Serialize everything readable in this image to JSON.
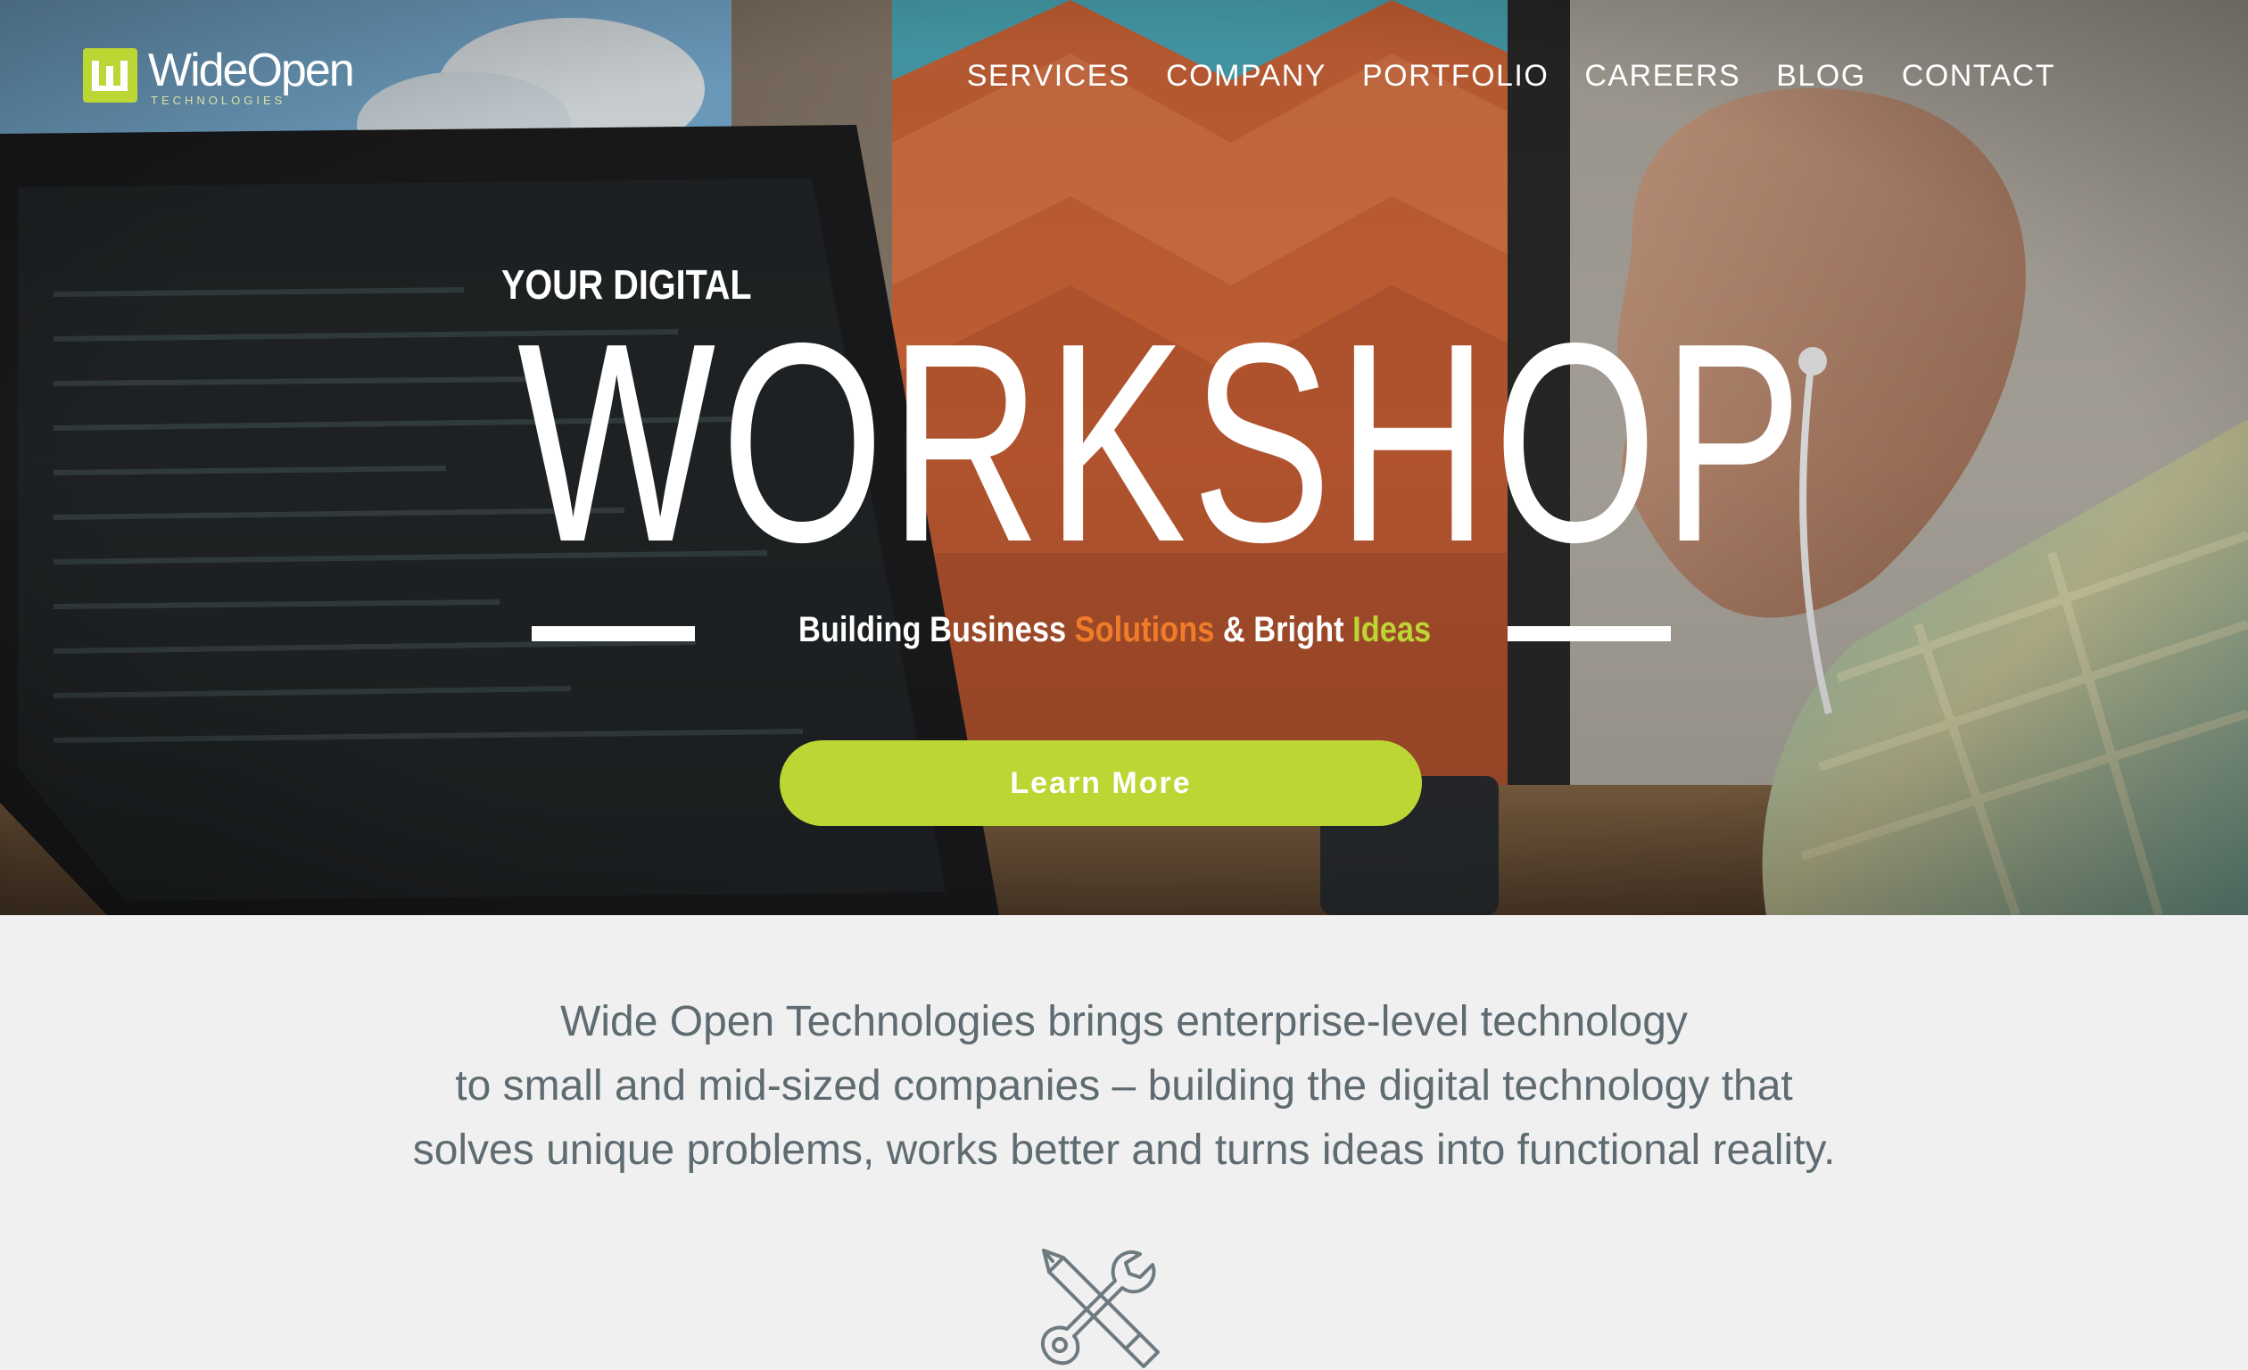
{
  "brand": {
    "name": "WideOpen",
    "tagline": "TECHNOLOGIES"
  },
  "nav": {
    "items": [
      {
        "label": "SERVICES"
      },
      {
        "label": "COMPANY"
      },
      {
        "label": "PORTFOLIO"
      },
      {
        "label": "CAREERS"
      },
      {
        "label": "BLOG"
      },
      {
        "label": "CONTACT"
      }
    ]
  },
  "hero": {
    "kicker": "YOUR DIGITAL",
    "headline": "WORKSHOP",
    "tagline_parts": [
      "Building Business ",
      "Solutions",
      " & Bright ",
      "Ideas"
    ],
    "cta_label": "Learn More"
  },
  "intro": {
    "lines": [
      "Wide Open Technologies brings enterprise-level technology",
      "to small and mid-sized companies – building the digital technology that",
      "solves unique problems, works better and turns ideas into functional reality."
    ]
  },
  "icons": {
    "logo": "wideopen-logo-icon",
    "section": "pencil-wrench-icon"
  },
  "colors": {
    "accent_green": "#bcd634",
    "accent_orange": "#f07c2a",
    "body_text": "#5e6b70",
    "page_bg": "#f0f0f0"
  }
}
